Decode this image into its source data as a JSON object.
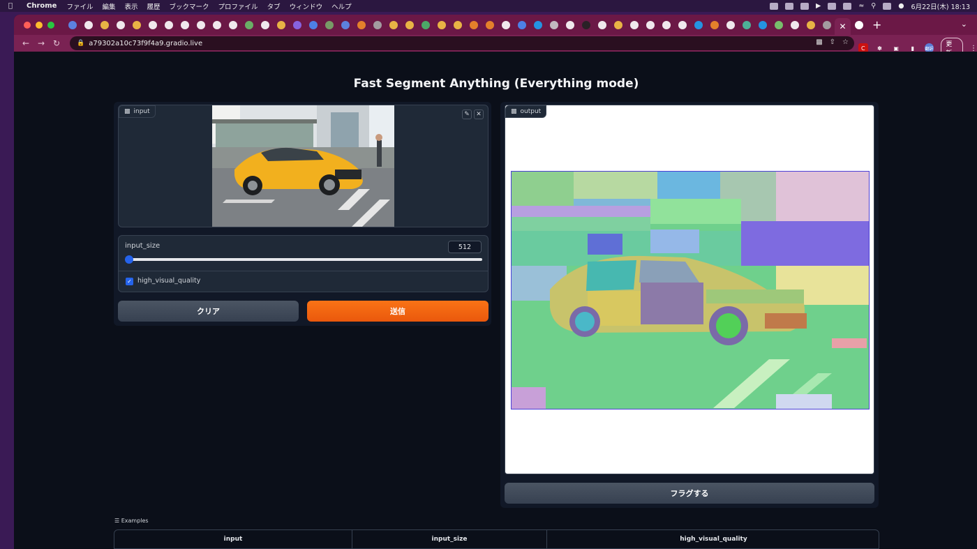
{
  "menubar": {
    "app_name": "Chrome",
    "items": [
      "ファイル",
      "編集",
      "表示",
      "履歴",
      "ブックマーク",
      "プロファイル",
      "タブ",
      "ウィンドウ",
      "ヘルプ"
    ],
    "datetime": "6月22日(木)  18:13"
  },
  "browser": {
    "url": "a79302a10c73f9f4a9.gradio.live",
    "update_label": "更新",
    "ext_badge": "翻訳"
  },
  "app": {
    "title": "Fast Segment Anything (Everything mode)",
    "input_label": "input",
    "output_label": "output",
    "slider_label": "input_size",
    "slider_value": "512",
    "slider_fraction": 0.0,
    "checkbox_label": "high_visual_quality",
    "checkbox_checked": true,
    "clear_label": "クリア",
    "submit_label": "送信",
    "flag_label": "フラグする"
  },
  "examples": {
    "label": "Examples",
    "columns": [
      "input",
      "input_size",
      "high_visual_quality"
    ]
  },
  "colors": {
    "accent_orange": "#ea580c",
    "accent_blue": "#2563eb",
    "tab_strip": "#6b1846",
    "page_bg": "#0b0f19"
  }
}
